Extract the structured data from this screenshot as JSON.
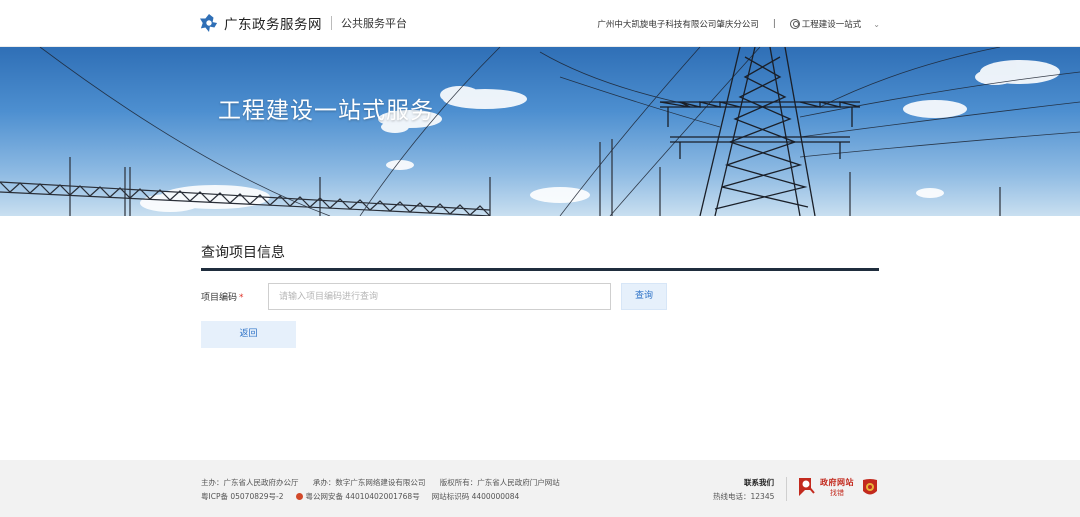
{
  "header": {
    "logo_text": "广东政务服务网",
    "subtitle": "公共服务平台",
    "company": "广州中大凯旋电子科技有限公司肇庆分公司",
    "separator": "|",
    "user_menu": "工程建设一站式",
    "user_menu_chevron": "⌄"
  },
  "banner": {
    "title": "工程建设一站式服务"
  },
  "main": {
    "section_title": "查询项目信息",
    "field_label": "项目编码",
    "required_mark": "*",
    "input_value": "",
    "input_placeholder": "请输入项目编码进行查询",
    "query_button": "查询",
    "back_button": "返回"
  },
  "footer": {
    "sponsor": "主办：广东省人民政府办公厅",
    "undertaker": "承办：数字广东网络建设有限公司",
    "copyright": "版权所有：广东省人民政府门户网站",
    "icp": "粤ICP备 05070829号-2",
    "police": "粤公网安备 44010402001768号",
    "site_id": "网站标识码 4400000084",
    "contact": "联系我们",
    "hotline": "热线电话：12345",
    "fix_title": "政府网站",
    "fix_sub": "找错"
  },
  "colors": {
    "accent": "#2f73c7",
    "button_bg": "#e6f0fb",
    "rule": "#1f2d3d",
    "required": "#e0352b",
    "footer_bg": "#f2f2f2"
  },
  "icons": [
    "gd-logo-icon",
    "user-icon",
    "chevron-down-icon",
    "police-badge-icon",
    "magnifier-icon",
    "national-emblem-icon"
  ]
}
